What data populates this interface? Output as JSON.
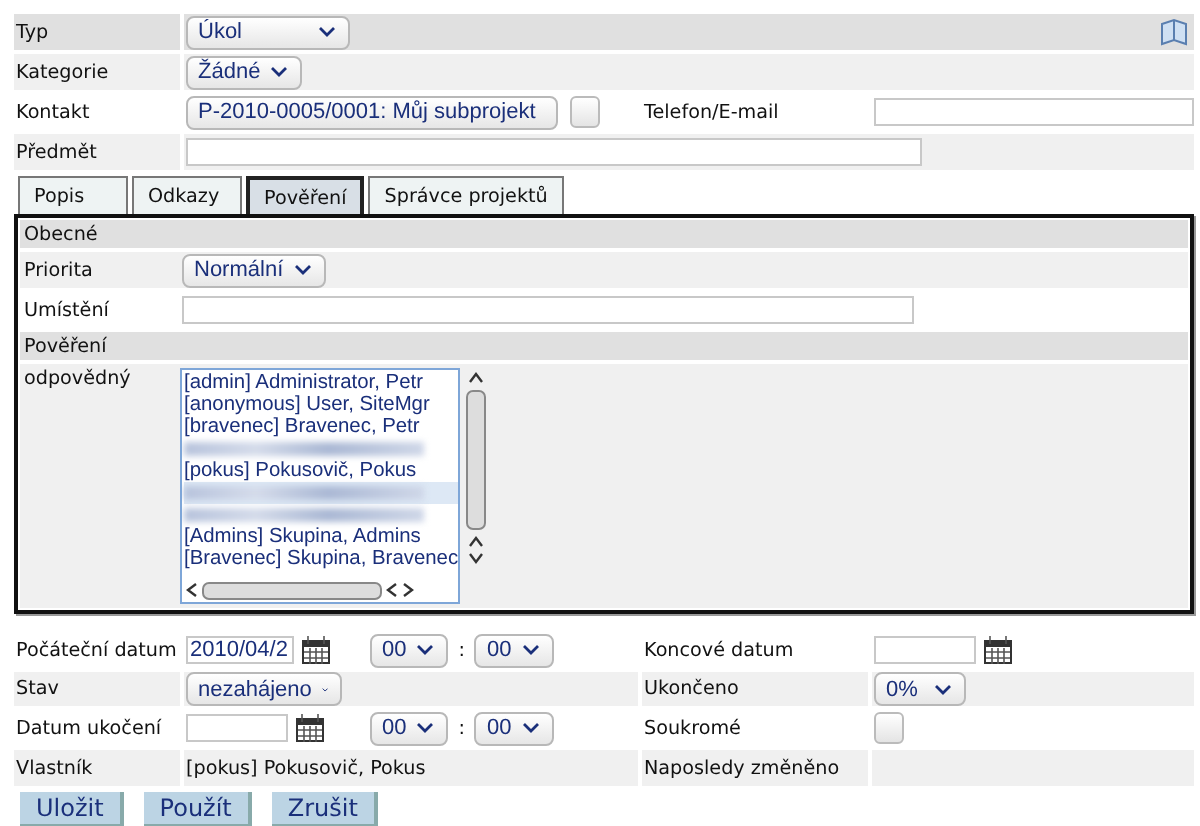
{
  "type_field": {
    "label": "Typ",
    "value": "Úkol"
  },
  "category_field": {
    "label": "Kategorie",
    "value": "Žádné"
  },
  "contact_field": {
    "label": "Kontakt",
    "value": "P-2010-0005/0001: Můj subprojekt",
    "checked": false
  },
  "phone_field": {
    "label": "Telefon/E-mail"
  },
  "subject_field": {
    "label": "Předmět"
  },
  "tabs": [
    {
      "label": "Popis",
      "selected": false
    },
    {
      "label": "Odkazy",
      "selected": false
    },
    {
      "label": "Pověření",
      "selected": true
    },
    {
      "label": "Správce projektů",
      "selected": false
    }
  ],
  "panel": {
    "general_header": "Obecné",
    "priority": {
      "label": "Priorita",
      "value": "Normální"
    },
    "location": {
      "label": "Umístění"
    },
    "assignment_header": "Pověření",
    "responsible": {
      "label": "odpovědný",
      "options": [
        {
          "kind": "text",
          "label": "[admin] Administrator, Petr",
          "selected": false
        },
        {
          "kind": "text",
          "label": "[anonymous] User, SiteMgr",
          "selected": false
        },
        {
          "kind": "text",
          "label": "[bravenec] Bravenec, Petr",
          "selected": false
        },
        {
          "kind": "redacted",
          "selected": false
        },
        {
          "kind": "text",
          "label": "[pokus] Pokusovič, Pokus",
          "selected": false
        },
        {
          "kind": "redacted",
          "selected": true
        },
        {
          "kind": "redacted",
          "selected": false
        },
        {
          "kind": "text",
          "label": "[Admins] Skupina, Admins",
          "selected": false
        },
        {
          "kind": "text",
          "label": "[Bravenec] Skupina, Bravenec",
          "selected": false
        }
      ]
    }
  },
  "start_date": {
    "label": "Počáteční datum",
    "value": "2010/04/2",
    "hour": "00",
    "separator": ":",
    "minute": "00"
  },
  "end_date": {
    "label": "Koncové datum"
  },
  "status": {
    "label": "Stav",
    "value": "nezahájeno"
  },
  "completed": {
    "label": "Ukončeno",
    "value": "0%"
  },
  "completion_date": {
    "label": "Datum ukočení",
    "hour": "00",
    "separator": ":",
    "minute": "00"
  },
  "private": {
    "label": "Soukromé",
    "checked": false
  },
  "owner": {
    "label": "Vlastník",
    "value": "[pokus] Pokusovič, Pokus"
  },
  "last_modified": {
    "label": "Naposledy změněno"
  },
  "buttons": [
    "Uložit",
    "Použít",
    "Zrušit"
  ]
}
